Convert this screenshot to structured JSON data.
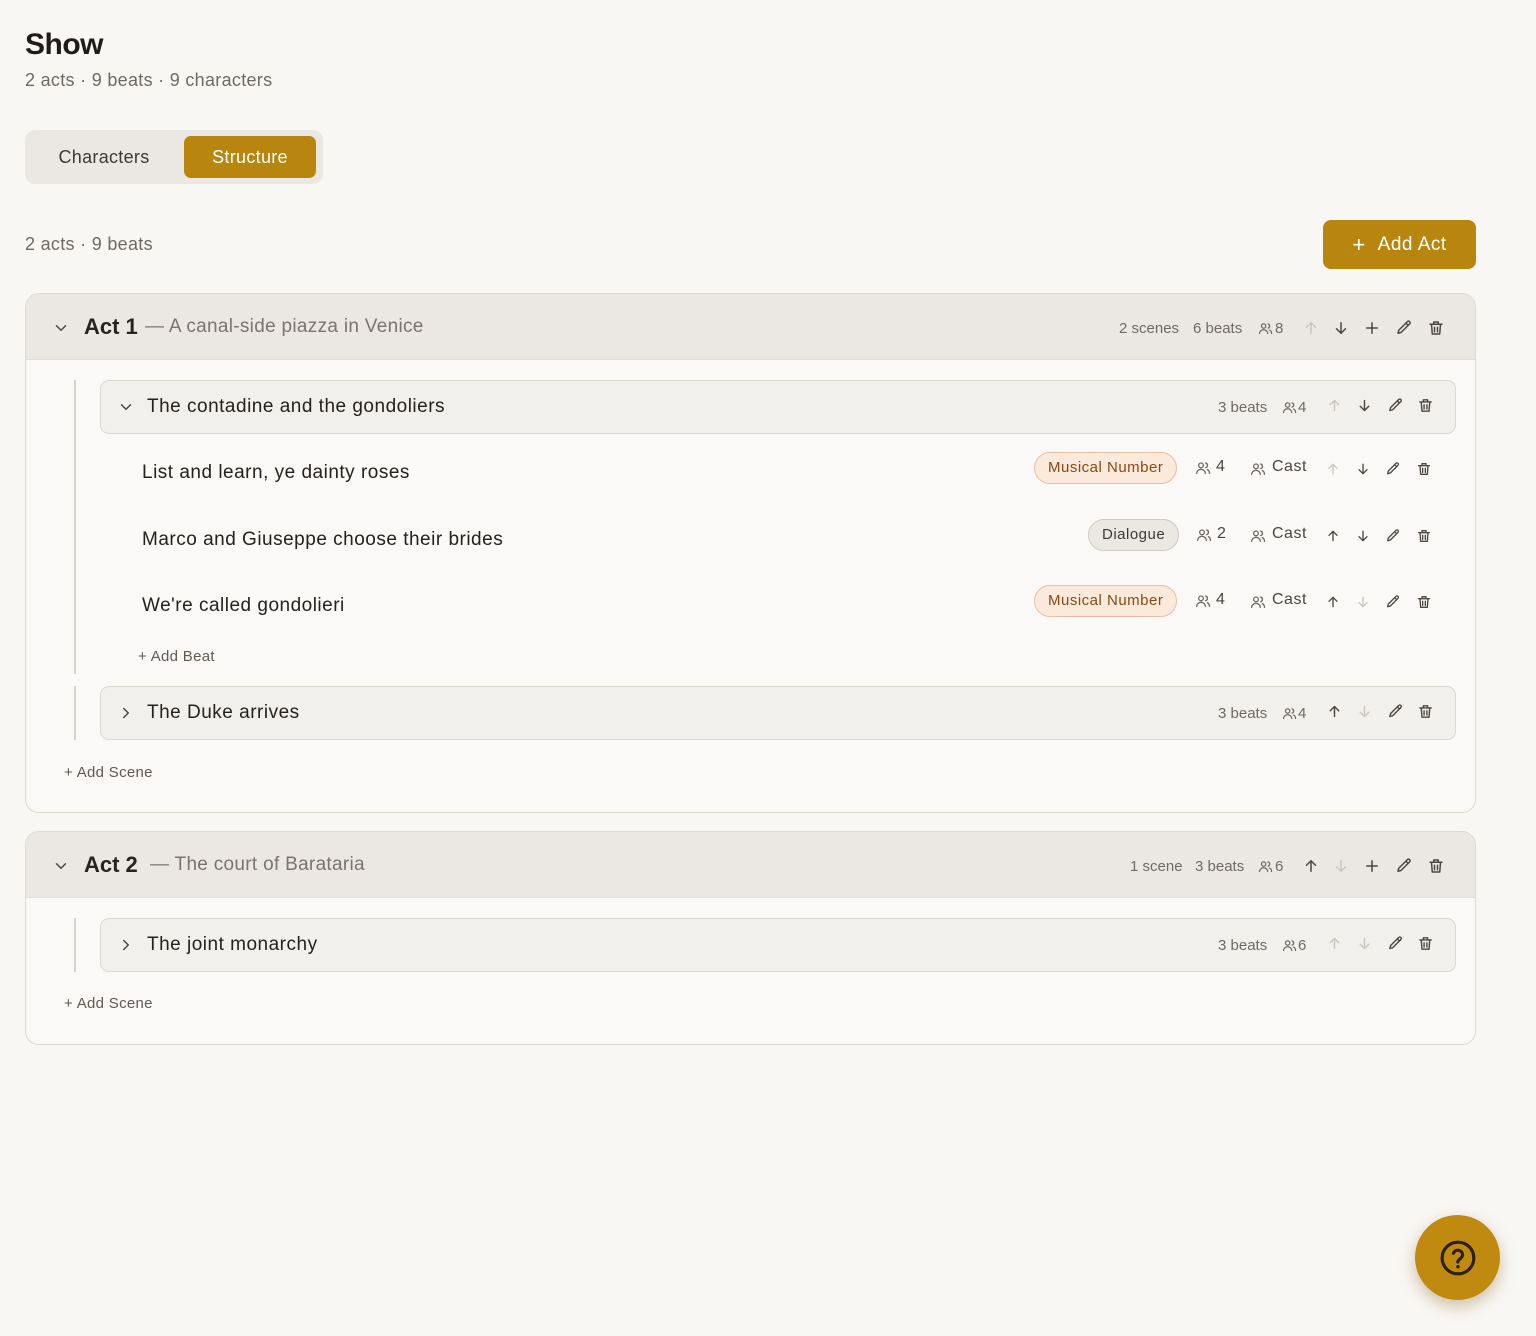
{
  "header": {
    "title": "Show",
    "subtitle": "2 acts · 9 beats · 9 characters"
  },
  "tabs": {
    "characters": "Characters",
    "structure": "Structure"
  },
  "toolbar": {
    "summary": "2 acts · 9 beats",
    "add_act": "Add Act"
  },
  "acts": [
    {
      "title": "Act 1",
      "location": "— A canal-side piazza in Venice",
      "scenes_count": "2 scenes",
      "beats_count": "6 beats",
      "characters": "8",
      "add_scene": "Add Scene",
      "scenes": [
        {
          "title": "The contadine and the gondoliers",
          "beats_count": "3 beats",
          "characters": "4",
          "add_beat": "Add Beat",
          "beats": [
            {
              "title": "List and learn, ye dainty roses",
              "type": "Musical Number",
              "characters": "4",
              "cast": "Cast"
            },
            {
              "title": "Marco and Giuseppe choose their brides",
              "type": "Dialogue",
              "characters": "2",
              "cast": "Cast"
            },
            {
              "title": "We're called gondolieri",
              "type": "Musical Number",
              "characters": "4",
              "cast": "Cast"
            }
          ]
        },
        {
          "title": "The Duke arrives",
          "beats_count": "3 beats",
          "characters": "4"
        }
      ]
    },
    {
      "title": "Act 2",
      "location": "— The court of Barataria",
      "scenes_count": "1 scene",
      "beats_count": "3 beats",
      "characters": "6",
      "add_scene": "Add Scene",
      "scenes": [
        {
          "title": "The joint monarchy",
          "beats_count": "3 beats",
          "characters": "6"
        }
      ]
    }
  ],
  "colors": {
    "accent": "#b8860f",
    "background": "#f9f7f4",
    "musical_badge": "#fbe9dc",
    "dialogue_badge": "#ebe8e3"
  }
}
